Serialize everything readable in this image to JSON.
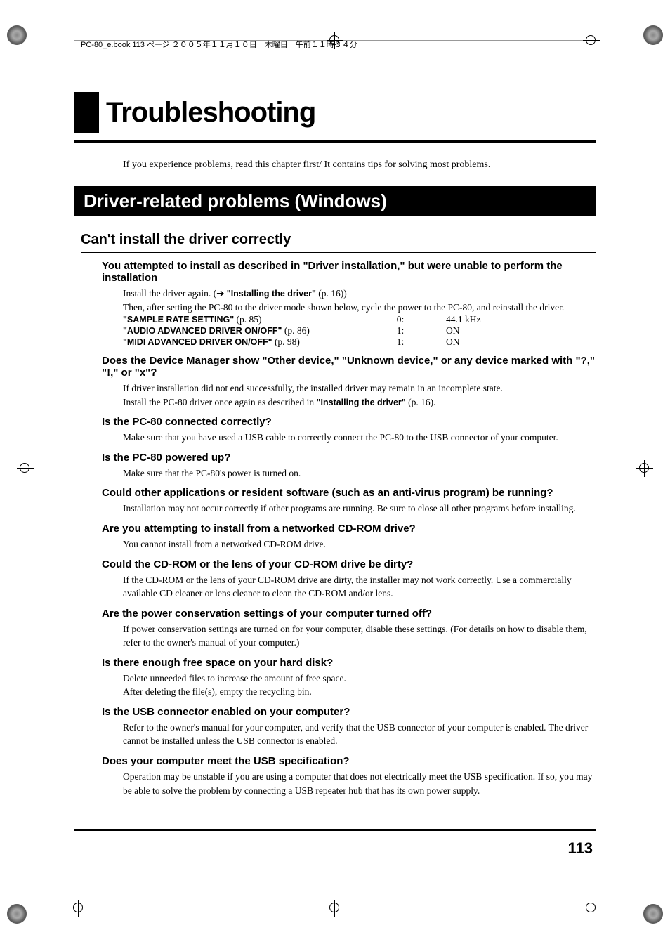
{
  "meta_line": "PC-80_e.book  113 ページ  ２００５年１１月１０日　木曜日　午前１１時３４分",
  "chapter_title": "Troubleshooting",
  "intro": "If you experience problems, read this chapter first/ It contains tips for solving most problems.",
  "section_banner": "Driver-related problems (Windows)",
  "h2": "Can't install the driver correctly",
  "items": [
    {
      "h3": "You attempted to install as described in \"Driver installation,\" but were unable to perform the installation",
      "body_pre": "Install the driver again. (➔ ",
      "body_bold1": "\"Installing the driver\"",
      "body_post1": " (p. 16))",
      "body2": "Then, after setting the PC-80 to the driver mode shown below, cycle the power to the PC-80, and reinstall the driver.",
      "settings": [
        {
          "label": "\"SAMPLE RATE SETTING\"",
          "ref": " (p. 85)",
          "col2": "0:",
          "col3": "44.1 kHz"
        },
        {
          "label": "\"AUDIO ADVANCED DRIVER ON/OFF\"",
          "ref": " (p. 86)",
          "col2": "1:",
          "col3": "ON"
        },
        {
          "label": "\"MIDI ADVANCED DRIVER ON/OFF\"",
          "ref": " (p. 98)",
          "col2": "1:",
          "col3": "ON"
        }
      ]
    },
    {
      "h3": "Does the Device Manager show \"Other device,\" \"Unknown device,\" or any device marked with \"?,\" \"!,\" or \"x\"?",
      "body": "If driver installation did not end successfully, the installed driver may remain in an incomplete state.",
      "body2_pre": "Install the PC-80 driver once again as described in ",
      "body2_bold": "\"Installing the driver\"",
      "body2_post": " (p. 16)."
    },
    {
      "h3": "Is the PC-80 connected correctly?",
      "body": "Make sure that you have used a USB cable to correctly connect the PC-80 to the USB connector of your computer."
    },
    {
      "h3": "Is the PC-80 powered up?",
      "body": "Make sure that the PC-80's power is turned on."
    },
    {
      "h3": "Could other applications or resident software (such as an anti-virus program) be running?",
      "body": "Installation may not occur correctly if other programs are running. Be sure to close all other programs before installing."
    },
    {
      "h3": "Are you attempting to install from a networked CD-ROM drive?",
      "body": "You cannot install from a networked CD-ROM drive."
    },
    {
      "h3": "Could the CD-ROM or the lens of your CD-ROM drive be dirty?",
      "body": "If the CD-ROM or the lens of your CD-ROM drive are dirty, the installer may not work correctly. Use a commercially available CD cleaner or lens cleaner to clean the CD-ROM and/or lens."
    },
    {
      "h3": "Are the power conservation settings of your computer turned off?",
      "body": "If power conservation settings are turned on for your computer, disable these settings. (For details on how to disable them, refer to the owner's manual of your computer.)"
    },
    {
      "h3": "Is there enough free space on your hard disk?",
      "body": "Delete unneeded files to increase the amount of free space.",
      "body2": "After deleting the file(s), empty the recycling bin."
    },
    {
      "h3": "Is the USB connector enabled on your computer?",
      "body": "Refer to the owner's manual for your computer, and verify that the USB connector of your computer is enabled. The driver cannot be installed unless the USB connector is enabled."
    },
    {
      "h3": "Does your computer meet the USB specification?",
      "body": "Operation may be unstable if you are using a computer that does not electrically meet the USB specification. If so, you may be able to solve the problem by connecting a USB repeater hub that has its own power supply."
    }
  ],
  "page_number": "113"
}
